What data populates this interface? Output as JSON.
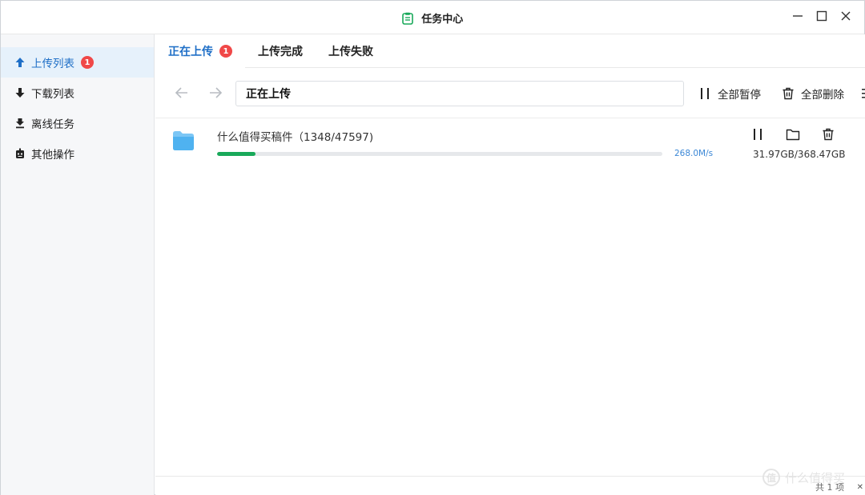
{
  "window": {
    "title": "任务中心",
    "controls": [
      "minimize",
      "maximize",
      "close"
    ]
  },
  "sidebar": {
    "items": [
      {
        "label": "上传列表",
        "icon": "arrow-up-icon",
        "badge": "1",
        "active": true
      },
      {
        "label": "下载列表",
        "icon": "arrow-down-icon"
      },
      {
        "label": "离线任务",
        "icon": "offline-download-icon"
      },
      {
        "label": "其他操作",
        "icon": "robot-icon"
      }
    ]
  },
  "tabs": [
    {
      "label": "正在上传",
      "badge": "1",
      "active": true
    },
    {
      "label": "上传完成"
    },
    {
      "label": "上传失败"
    }
  ],
  "toolbar": {
    "path": "正在上传",
    "pause_all": "全部暂停",
    "delete_all": "全部删除"
  },
  "tasks": [
    {
      "name": "什么值得买稿件（1348/47597)",
      "speed": "268.0M/s",
      "size": "31.97GB/368.47GB",
      "progress": 0.087
    }
  ],
  "footer": {
    "page_count": "共 1 项"
  },
  "watermark": {
    "text": "什么值得买",
    "symbol": "值"
  },
  "colors": {
    "accent": "#1f6fc7",
    "progress": "#19a95a",
    "badge": "#f04848",
    "speed": "#3b87d6"
  }
}
